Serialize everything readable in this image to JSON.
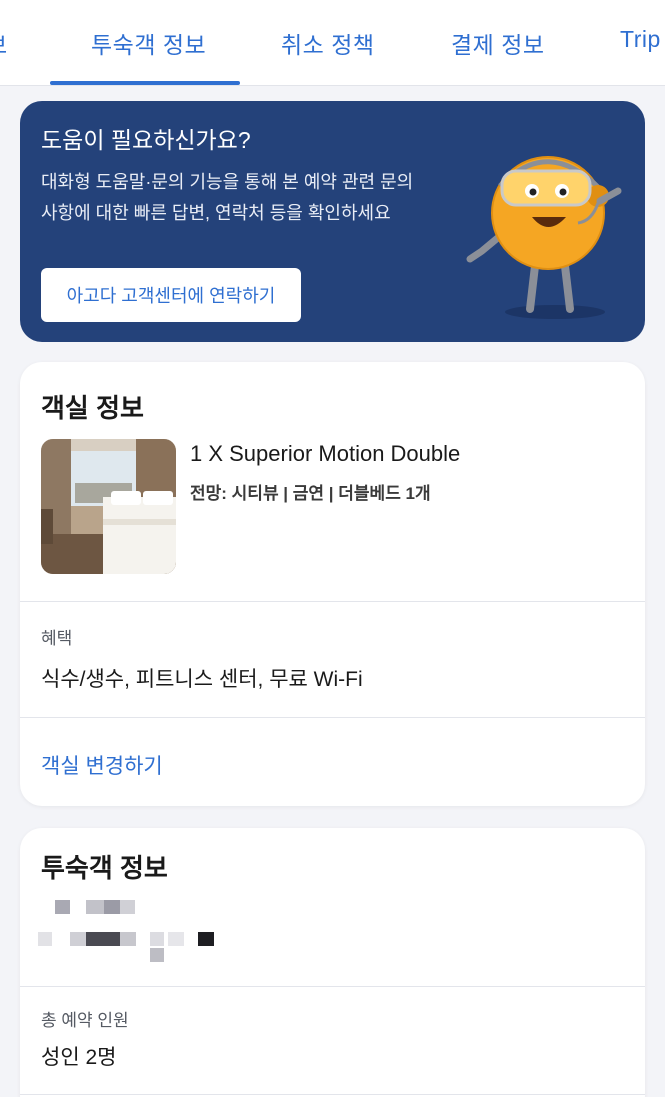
{
  "tabs": [
    {
      "label": "보"
    },
    {
      "label": "투숙객 정보"
    },
    {
      "label": "취소 정책"
    },
    {
      "label": "결제 정보"
    },
    {
      "label": "Trip"
    }
  ],
  "help": {
    "title": "도움이 필요하신가요?",
    "description": "대화형 도움말·문의 기능을 통해 본 예약 관련 문의 사항에 대한 빠른 답변, 연락처 등을 확인하세요",
    "button_label": "아고다 고객센터에 연락하기"
  },
  "room": {
    "section_title": "객실 정보",
    "name": "1 X Superior Motion Double",
    "detail": "전망: 시티뷰 | 금연 | 더블베드 1개",
    "benefits_label": "혜택",
    "benefits_value": "식수/생수, 피트니스 센터, 무료 Wi-Fi",
    "change_link": "객실 변경하기"
  },
  "guest": {
    "section_title": "투숙객 정보",
    "total_label": "총 예약 인원",
    "total_value": "성인 2명"
  },
  "colors": {
    "accent": "#2f6fd1",
    "banner": "#24427a",
    "background": "#f3f4f8",
    "mascot": "#f5a623"
  }
}
